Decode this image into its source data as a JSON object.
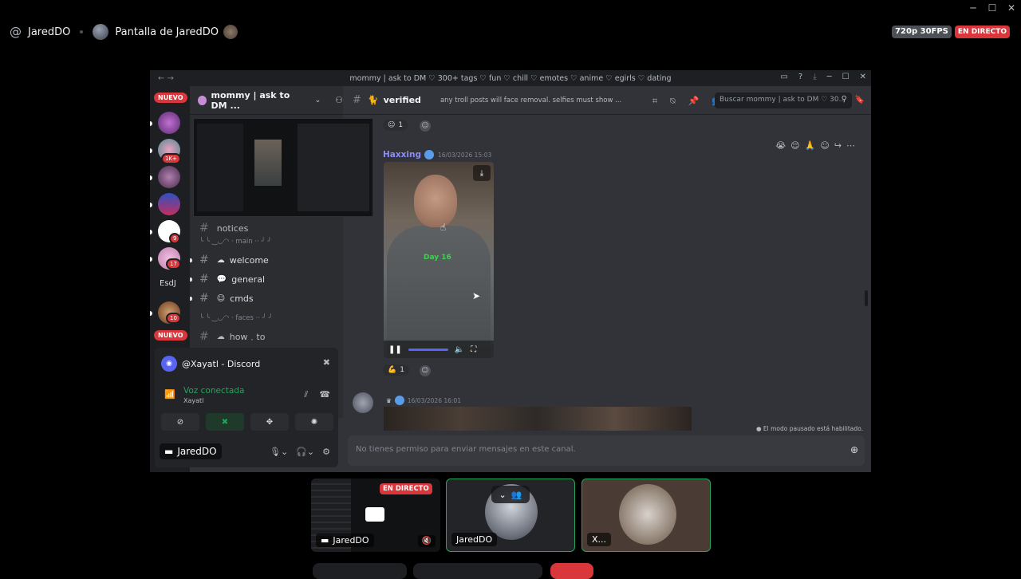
{
  "window": {
    "minimize": "─",
    "maximize": "☐",
    "close": "✕"
  },
  "topbar": {
    "at_icon": "@",
    "user": "JaredDO",
    "screen_title": "Pantalla de JaredDO",
    "quality": "720p 30FPS",
    "live": "EN DIRECTO"
  },
  "share": {
    "title": "mommy | ask to DM ♡ 300+ tags ♡ fun ♡ chill ♡ emotes ♡ anime ♡ egirls ♡ dating",
    "guilds": {
      "nuevo_top": "NUEVO",
      "nuevo_bottom": "NUEVO",
      "badge_1k": "1K+",
      "badge_9": "9",
      "badge_17": "17",
      "badge_10": "10",
      "text_server": "EsdJ"
    },
    "server_name": "mommy | ask to DM ...",
    "categories": {
      "main": "╰ ╰ ‿◡◠ · main ‧‧ ╯ ╯",
      "faces": "╰ ╰ ‿◡◠ · faces ‧‧ ╯ ╯"
    },
    "channels": [
      {
        "name": "notices"
      },
      {
        "name": "welcome"
      },
      {
        "name": "general"
      },
      {
        "name": "cmds"
      },
      {
        "name": "how﹒to"
      }
    ],
    "user_panel": {
      "account": "@Xayatl - Discord",
      "voice_status": "Voz conectada",
      "voice_channel": "Xayatl",
      "stream_label": "JaredDO"
    },
    "chat": {
      "channel": "verified",
      "topic": "any troll posts will face removal. selfies must show ...",
      "search_placeholder": "Buscar mommy | ask to DM ♡ 30...",
      "reaction_top_count": "1",
      "author": "Haxxing",
      "timestamp": "16/03/2026 15:03",
      "video_overlay_text": "Day 16",
      "reaction_bottom_count": "1",
      "msg2_time": "16/03/2026 16:01",
      "paused_notice": "El modo pausado está habilitado.",
      "composer": "No tienes permiso para enviar mensajes en este canal."
    }
  },
  "tiles": [
    {
      "label": "JaredDO",
      "live": "EN DIRECTO"
    },
    {
      "label": "JaredDO"
    },
    {
      "label": "X..."
    }
  ],
  "colors": {
    "live": "#da373c",
    "speaking": "#23a55a",
    "accent": "#5865f2"
  }
}
